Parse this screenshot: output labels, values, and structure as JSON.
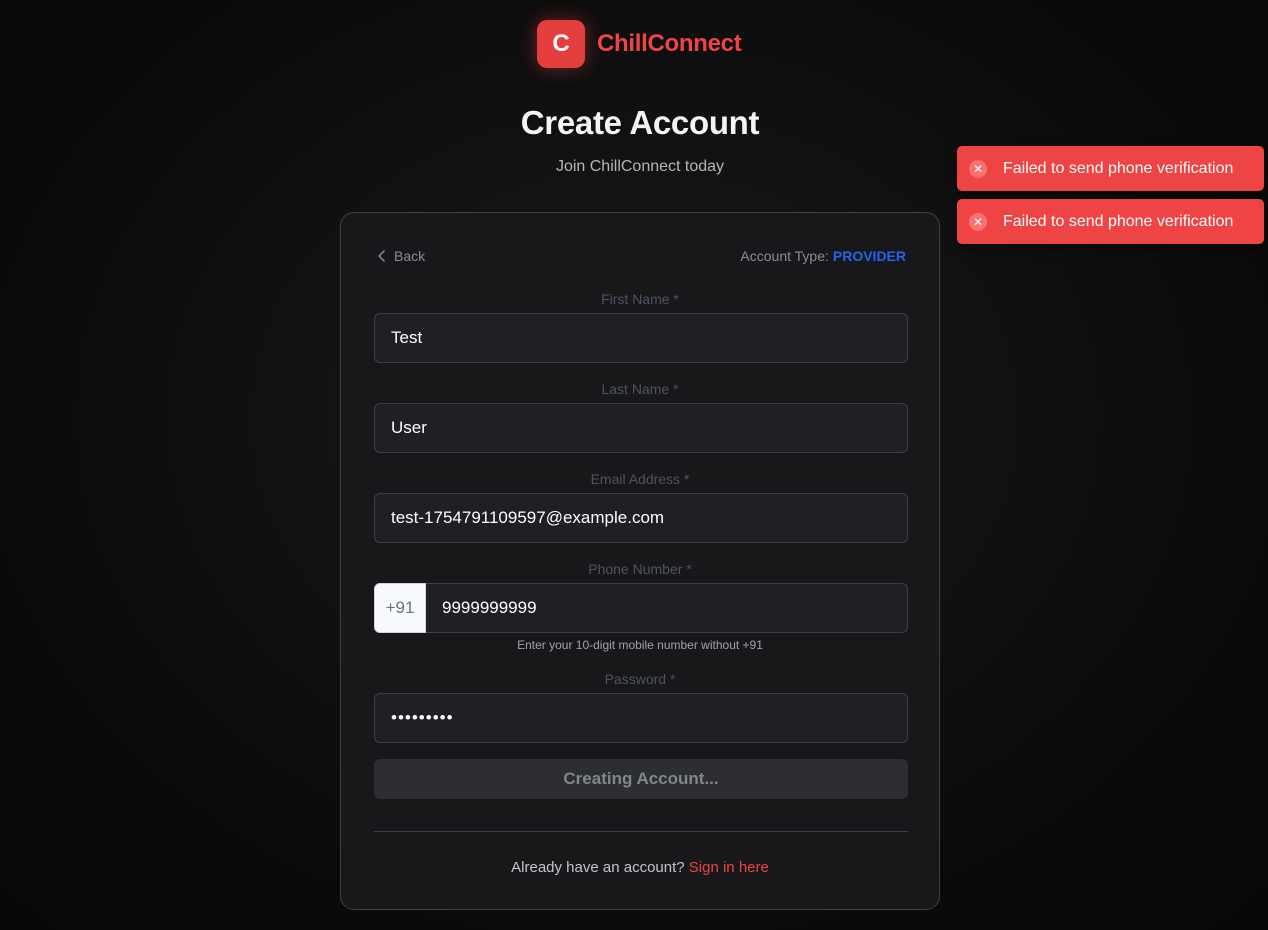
{
  "brand": {
    "logo_letter": "C",
    "name": "ChillConnect"
  },
  "header": {
    "title": "Create Account",
    "subtitle": "Join ChillConnect today"
  },
  "card": {
    "back_label": "Back",
    "account_type_label": "Account Type:",
    "account_type_value": "PROVIDER"
  },
  "form": {
    "first_name": {
      "label": "First Name *",
      "value": "Test"
    },
    "last_name": {
      "label": "Last Name *",
      "value": "User"
    },
    "email": {
      "label": "Email Address *",
      "value": "test-1754791109597@example.com"
    },
    "phone": {
      "label": "Phone Number *",
      "prefix": "+91",
      "value": "9999999999",
      "hint": "Enter your 10-digit mobile number without +91"
    },
    "password": {
      "label": "Password *",
      "value": "•••••••••"
    },
    "submit_label": "Creating Account..."
  },
  "footer": {
    "prompt": "Already have an account?",
    "link": "Sign in here"
  },
  "toasts": [
    {
      "message": "Failed to send phone verification",
      "icon": "error-x-icon"
    },
    {
      "message": "Failed to send phone verification",
      "icon": "error-x-icon"
    }
  ],
  "colors": {
    "brand_red": "#ef4444",
    "account_type_blue": "#2563eb",
    "toast_red": "#ef4444"
  }
}
